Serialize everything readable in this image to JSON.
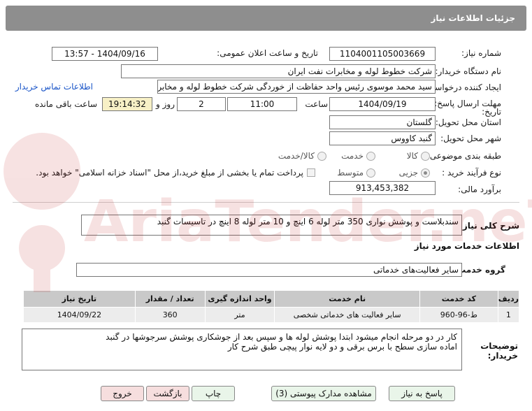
{
  "header": {
    "title": "جزئیات اطلاعات نیاز"
  },
  "fields": {
    "need_number_label": "شماره نیاز:",
    "need_number": "1104001105003669",
    "announce_label": "تاریخ و ساعت اعلان عمومی:",
    "announce_value": "1404/09/16 - 13:57",
    "buyer_label": "نام دستگاه خریدار:",
    "buyer_value": "شرکت خطوط لوله و مخابرات نفت ایران",
    "creator_label": "ایجاد کننده درخواست:",
    "creator_value": "سید محمد  موسوی رئیس واحد حفاظت از خوردگی شرکت خطوط لوله و مخابرات",
    "contact_link": "اطلاعات تماس خریدار",
    "deadline_label_1": "مهلت ارسال پاسخ: تا",
    "deadline_label_2": "تاریخ:",
    "deadline_date": "1404/09/19",
    "time_label": "ساعت",
    "deadline_time": "11:00",
    "days_value": "2",
    "days_label": "روز و",
    "remaining_time": "19:14:32",
    "remaining_label": "ساعت باقی مانده",
    "province_label": "استان محل تحویل:",
    "province_value": "گلستان",
    "city_label": "شهر محل تحویل:",
    "city_value": "گنبد کاووس",
    "category_label": "طبقه بندی موضوعی:",
    "category_options": [
      "کالا",
      "خدمت",
      "کالا/خدمت"
    ],
    "process_label": "نوع فرآیند خرید :",
    "process_options": [
      "جزیی",
      "متوسط"
    ],
    "payment_note": "پرداخت تمام یا بخشی از مبلغ خرید،از محل \"اسناد خزانه اسلامی\" خواهد بود.",
    "estimate_label": "برآورد مالی:",
    "estimate_value": "913,453,382"
  },
  "description": {
    "label": "شرح کلی نیاز:",
    "value": "سندبلاست و پوشش نواری 350 متر لوله 6 اینچ و 10 متر  لوله 8 اینچ در تاسیسات گنبد"
  },
  "services": {
    "title": "اطلاعات خدمات مورد نیاز",
    "group_label": "گروه خدمت:",
    "group_value": "سایر فعالیت‌های خدماتی",
    "columns": [
      "ردیف",
      "کد خدمت",
      "نام خدمت",
      "واحد اندازه گیری",
      "تعداد / مقدار",
      "تاریخ نیاز"
    ],
    "rows": [
      [
        "1",
        "ط-96-960",
        "سایر فعالیت های خدماتی شخصی",
        "متر",
        "360",
        "1404/09/22"
      ]
    ]
  },
  "buyer_notes": {
    "label_1": "توضیحات",
    "label_2": "خریدار:",
    "line_1": "کار در دو مرحله انجام میشود ابتدا پوشش لوله ها و سپس بعد از جوشکاری پوشش سرجوشها در گنبد",
    "line_2": "اماده سازی سطح با برس برقی و دو لایه نوار پیچی طبق شرح کار"
  },
  "buttons": {
    "reply": "پاسخ به نیاز",
    "docs": "مشاهده مدارک پیوستی (3)",
    "print": "چاپ",
    "back": "بازگشت",
    "exit": "خروج"
  },
  "watermark": {
    "text": "AriaTender.neT"
  },
  "colors": {
    "header_bg": "#8e8e8e",
    "link": "#1a55c8",
    "remaining_bg": "#f7f0c6",
    "table_head": "#c9c9c9"
  }
}
